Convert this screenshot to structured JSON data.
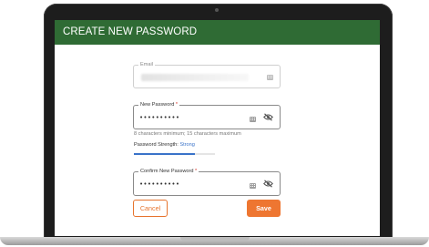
{
  "window": {
    "title": "CREATE NEW PASSWORD"
  },
  "form": {
    "email": {
      "label": "Email",
      "value": ""
    },
    "new_password": {
      "label": "New Password",
      "required_mark": "*",
      "value": "••••••••••",
      "helper": "8 characters minimum; 15 characters maximum"
    },
    "strength": {
      "label": "Password Strength:",
      "value": "Strong",
      "level": 0.75
    },
    "confirm_password": {
      "label": "Confirm New Password",
      "required_mark": "*",
      "value": "••••••••••"
    },
    "buttons": {
      "cancel": "Cancel",
      "save": "Save"
    }
  },
  "colors": {
    "header": "#2f6b34",
    "accent": "#ee7631",
    "strength": "#3a73c9"
  },
  "icons": {
    "field_icon": "keypad-icon",
    "visibility": "eye-off-icon"
  }
}
